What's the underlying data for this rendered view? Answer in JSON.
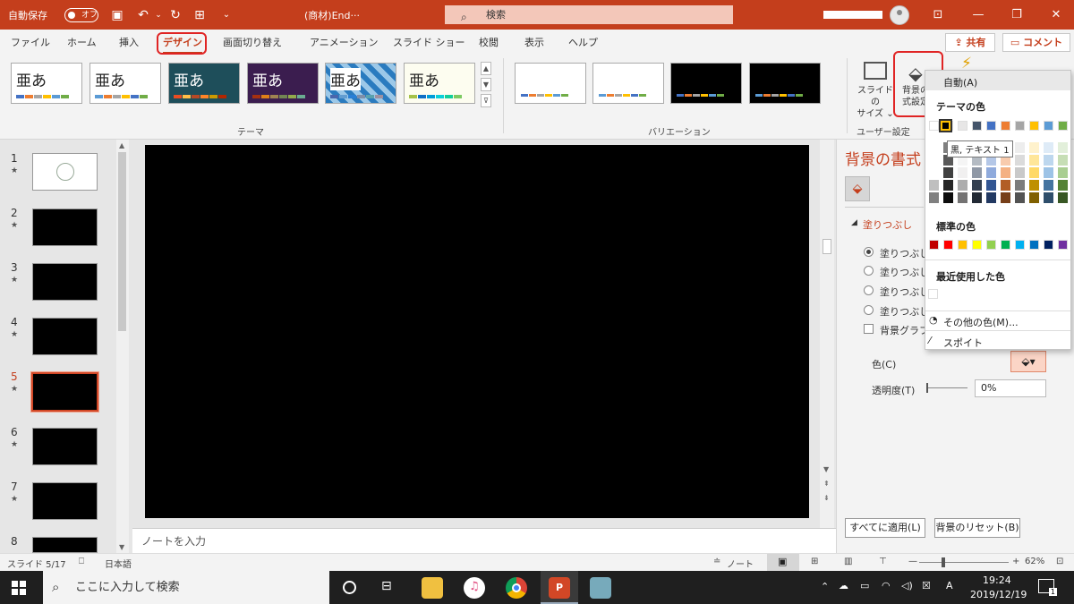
{
  "titlebar": {
    "autosave_label": "自動保存",
    "autosave_state": "オフ",
    "doc_title": "(商材)End···",
    "search_placeholder": "検索"
  },
  "tabs": [
    "ファイル",
    "ホーム",
    "挿入",
    "デザイン",
    "画面切り替え",
    "アニメーション",
    "スライド ショー",
    "校閲",
    "表示",
    "ヘルプ"
  ],
  "active_tab": "デザイン",
  "share_label": "共有",
  "comment_label": "コメント",
  "ribbon": {
    "theme_group": "テーマ",
    "variation_group": "バリエーション",
    "user_group": "ユーザー設定",
    "theme_sample": "亜あ",
    "slide_size_label1": "スライドの",
    "slide_size_label2": "サイズ ⌄",
    "bg_format_label1": "背景の",
    "bg_format_label2": "式設定"
  },
  "slides": [
    "1",
    "2",
    "3",
    "4",
    "5",
    "6",
    "7",
    "8"
  ],
  "current_slide": "5",
  "notes_placeholder": "ノートを入力",
  "format_pane": {
    "title": "背景の書式",
    "section": "塗りつぶし",
    "options": [
      "塗りつぶし (",
      "塗りつぶし (",
      "塗りつぶし (",
      "塗りつぶし (",
      "背景グラフィ"
    ],
    "color_label": "色(C)",
    "transparency_label": "透明度(T)",
    "transparency_value": "0%",
    "apply_all": "すべてに適用(L)",
    "reset_bg": "背景のリセット(B)"
  },
  "color_popup": {
    "auto": "自動(A)",
    "theme_colors": "テーマの色",
    "standard_colors": "標準の色",
    "recent_colors": "最近使用した色",
    "more_colors": "その他の色(M)...",
    "eyedropper": "スポイト",
    "tooltip": "黒, テキスト 1",
    "theme_top": [
      "#ffffff",
      "#000000",
      "#e7e6e6",
      "#44546a",
      "#4472c4",
      "#ed7d31",
      "#a5a5a5",
      "#ffc000",
      "#5b9bd5",
      "#70ad47"
    ],
    "standard": [
      "#c00000",
      "#ff0000",
      "#ffc000",
      "#ffff00",
      "#92d050",
      "#00b050",
      "#00b0f0",
      "#0070c0",
      "#002060",
      "#7030a0"
    ]
  },
  "statusbar": {
    "slide_info": "スライド 5/17",
    "language": "日本語",
    "notes": "ノート",
    "zoom": "62%"
  },
  "taskbar": {
    "search": "ここに入力して検索",
    "time": "19:24",
    "date": "2019/12/19",
    "notif": "1"
  }
}
